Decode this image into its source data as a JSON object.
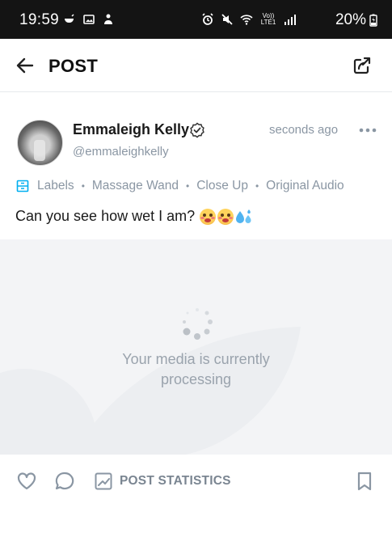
{
  "status_bar": {
    "time": "19:59",
    "battery": "20%",
    "network_label": "Vo)) LTE1"
  },
  "header": {
    "title": "POST"
  },
  "post": {
    "author_name": "Emmaleigh Kelly",
    "author_handle": "@emmaleighkelly",
    "timestamp": "seconds ago",
    "labels_title": "Labels",
    "labels": [
      "Massage Wand",
      "Close Up",
      "Original Audio"
    ],
    "text": "Can you see how wet I am?"
  },
  "media": {
    "processing_line1": "Your media is currently",
    "processing_line2": "processing"
  },
  "actions": {
    "stats_label": "POST STATISTICS"
  },
  "colors": {
    "muted": "#8a96a3",
    "accent": "#00aff0",
    "media_bg": "#f3f4f6",
    "status_bar": "#141414"
  }
}
